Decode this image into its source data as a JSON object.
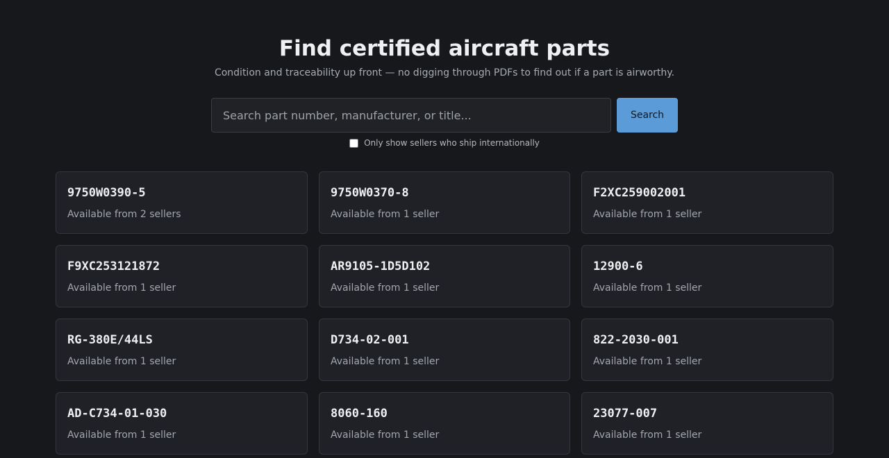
{
  "header": {
    "title": "Find certified aircraft parts",
    "subtitle": "Condition and traceability up front — no digging through PDFs to find out if a part is airworthy."
  },
  "search": {
    "placeholder": "Search part number, manufacturer, or title...",
    "value": "",
    "button_label": "Search",
    "intl_filter_label": "Only show sellers who ship internationally",
    "intl_filter_checked": false
  },
  "parts": [
    {
      "part_number": "9750W0390-5",
      "availability": "Available from 2 sellers"
    },
    {
      "part_number": "9750W0370-8",
      "availability": "Available from 1 seller"
    },
    {
      "part_number": "F2XC259002001",
      "availability": "Available from 1 seller"
    },
    {
      "part_number": "F9XC253121872",
      "availability": "Available from 1 seller"
    },
    {
      "part_number": "AR9105-1D5D102",
      "availability": "Available from 1 seller"
    },
    {
      "part_number": "12900-6",
      "availability": "Available from 1 seller"
    },
    {
      "part_number": "RG-380E/44LS",
      "availability": "Available from 1 seller"
    },
    {
      "part_number": "D734-02-001",
      "availability": "Available from 1 seller"
    },
    {
      "part_number": "822-2030-001",
      "availability": "Available from 1 seller"
    },
    {
      "part_number": "AD-C734-01-030",
      "availability": "Available from 1 seller"
    },
    {
      "part_number": "8060-160",
      "availability": "Available from 1 seller"
    },
    {
      "part_number": "23077-007",
      "availability": "Available from 1 seller"
    }
  ],
  "colors": {
    "background": "#17181c",
    "card": "#1f2126",
    "accent": "#5b9bd8"
  }
}
